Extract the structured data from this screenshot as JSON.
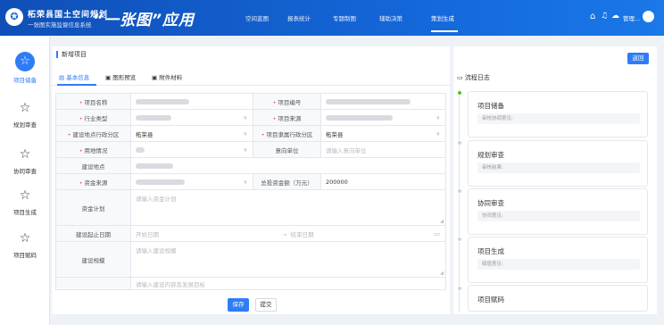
{
  "header": {
    "logo_icon": "emblem-icon",
    "brand_line1": "柘荣县国土空间规划",
    "brand_line2": "一张图实施监督信息系统",
    "app_title": "“一张图”应用",
    "nav": [
      "空间蓝图",
      "报表统计",
      "专题制图",
      "辅助决策",
      "策划生成"
    ],
    "active_nav": 4,
    "user": "管理...",
    "icons": [
      "home-icon",
      "bell-icon",
      "cloud-icon"
    ],
    "accent": "#1466d8"
  },
  "sidebar": {
    "items": [
      {
        "label": "项目储备",
        "icon": "star-icon",
        "active": true
      },
      {
        "label": "规划审查",
        "icon": "star-icon",
        "active": false
      },
      {
        "label": "协同审查",
        "icon": "star-icon",
        "active": false
      },
      {
        "label": "项目生成",
        "icon": "star-icon",
        "active": false
      },
      {
        "label": "项目赋码",
        "icon": "star-icon",
        "active": false
      }
    ]
  },
  "page": {
    "title": "新增项目",
    "back": "返回"
  },
  "tabs": [
    "基本信息",
    "图形预览",
    "附件材料"
  ],
  "form": {
    "project_name_label": "项目名称",
    "project_code_label": "项目编号",
    "industry_label": "行业类型",
    "source_label": "项目来源",
    "district_label": "建设地点行政分区",
    "district_value": "柘荣县",
    "belong_label": "项目隶属行政分区",
    "belong_value": "柘荣县",
    "land_label": "用地情况",
    "intent_label": "意向单位",
    "intent_placeholder": "请输入意向单位",
    "site_label": "建设地点",
    "fund_label": "资金来源",
    "invest_label": "总投资金额（万元）",
    "invest_value": "200000",
    "plan_label": "资金计划",
    "plan_placeholder": "请输入资金计划",
    "period_label": "建设起止日期",
    "start_placeholder": "开始日期",
    "end_placeholder": "结束日期",
    "date_sep": "→",
    "scale_label": "建设规模",
    "scale_placeholder": "请输入建设规模",
    "content_placeholder": "请输入建设内容及发展目标"
  },
  "buttons": {
    "save": "保存",
    "submit": "提交"
  },
  "flow": {
    "title": "流程日志",
    "steps": [
      {
        "name": "项目储备",
        "note": "审核协调意见:",
        "done": true
      },
      {
        "name": "规划审查",
        "note": "审核结果:",
        "done": false
      },
      {
        "name": "协同审查",
        "note": "协同意见:",
        "done": false
      },
      {
        "name": "项目生成",
        "note": "赋值意见:",
        "done": false
      },
      {
        "name": "项目赋码",
        "note": "",
        "done": false
      }
    ]
  }
}
